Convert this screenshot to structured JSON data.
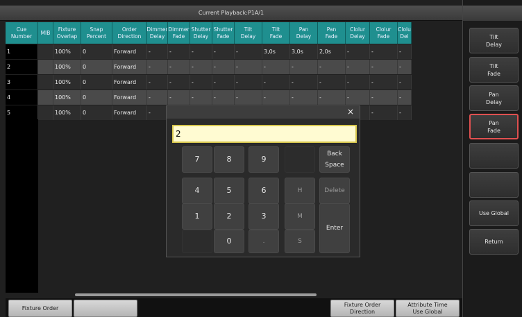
{
  "window": {
    "title": "Current Playback:P1A/1"
  },
  "table": {
    "headers": [
      "Cue\nNumber",
      "MIB",
      "Fixture\nOverlap",
      "Snap\nPercent",
      "Order\nDirection",
      "Dimmer\nDelay",
      "Dimmer\nFade",
      "Shutter\nDelay",
      "Shutter\nFade",
      "Tilt\nDelay",
      "Tilt\nFade",
      "Pan\nDelay",
      "Pan\nFade",
      "Clolur\nDelay",
      "Clolur\nFade",
      "Clolu\nDel"
    ],
    "rows": [
      [
        "1",
        "",
        "100%",
        "0",
        "Forward",
        "-",
        "-",
        "-",
        "-",
        "-",
        "3,0s",
        "3,0s",
        "2,0s",
        "-",
        "-",
        "-"
      ],
      [
        "2",
        "",
        "100%",
        "0",
        "Forward",
        "-",
        "-",
        "-",
        "-",
        "-",
        "-",
        "-",
        "-",
        "-",
        "-",
        "-"
      ],
      [
        "3",
        "",
        "100%",
        "0",
        "Forward",
        "-",
        "-",
        "-",
        "-",
        "-",
        "-",
        "-",
        "-",
        "-",
        "-",
        "-"
      ],
      [
        "4",
        "",
        "100%",
        "0",
        "Forward",
        "-",
        "-",
        "-",
        "-",
        "-",
        "-",
        "-",
        "-",
        "-",
        "-",
        "-"
      ],
      [
        "5",
        "",
        "100%",
        "0",
        "Forward",
        "-",
        "",
        "",
        "",
        "",
        "",
        "",
        "",
        "-",
        "-",
        "-"
      ]
    ]
  },
  "bottom": {
    "fixture_order": "Fixture Order",
    "blank": "",
    "fixture_order_direction": "Fixture Order\nDirection",
    "attribute_time": "Attribute Time\nUse Global"
  },
  "sidebar": {
    "tilt_delay": "Tilt\nDelay",
    "tilt_fade": "Tilt\nFade",
    "pan_delay": "Pan\nDelay",
    "pan_fade": "Pan\nFade",
    "blank1": "",
    "blank2": "",
    "use_global": "Use Global",
    "return": "Return"
  },
  "keypad": {
    "close": "×",
    "input_value": "2",
    "k7": "7",
    "k8": "8",
    "k9": "9",
    "k4": "4",
    "k5": "5",
    "k6": "6",
    "k1": "1",
    "k2": "2",
    "k3": "3",
    "k0": "0",
    "dot": ".",
    "h": "H",
    "m": "M",
    "s": "S",
    "backspace": "Back\nSpace",
    "delete": "Delete",
    "enter": "Enter"
  }
}
